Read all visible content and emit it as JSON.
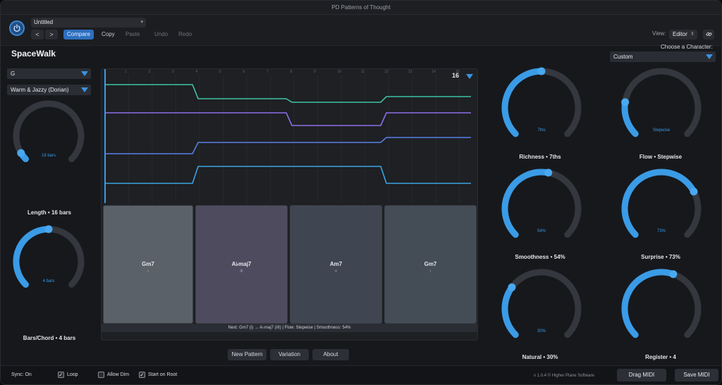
{
  "window": {
    "title": "PD Patterns of Thought"
  },
  "header": {
    "preset": "Untitled",
    "nav_prev": "<",
    "nav_next": ">",
    "compare": "Compare",
    "copy": "Copy",
    "paste": "Paste",
    "undo": "Undo",
    "redo": "Redo",
    "view_label": "View:",
    "view_value": "Editor",
    "link_icon": "link-icon"
  },
  "app_name": "SpaceWalk",
  "left": {
    "key": "G",
    "mode": "Warm & Jazzy (Dorian)",
    "knobs": [
      {
        "label": "Length • 16 bars",
        "inner": "16 bars",
        "level": 0.05
      },
      {
        "label": "Bars/Chord • 4 bars",
        "inner": "4 bars",
        "level": 0.5
      }
    ]
  },
  "editor": {
    "steps": "16",
    "beat_numbers": [
      "1",
      "2",
      "3",
      "4",
      "5",
      "6",
      "7",
      "8",
      "9",
      "10",
      "11",
      "12",
      "13",
      "14",
      "15",
      "16"
    ],
    "chords": [
      {
        "name": "Gm7",
        "numeral": "i"
      },
      {
        "name": "A♭maj7",
        "numeral": "III"
      },
      {
        "name": "Am7",
        "numeral": "ii"
      },
      {
        "name": "Gm7",
        "numeral": "i"
      }
    ],
    "status": "Next: Gm7 (i) → A♭maj7 (III)  |  Flow: Stepwise  |  Smoothness: 54%"
  },
  "buttons": {
    "new_pattern": "New Pattern",
    "variation": "Variation",
    "about": "About"
  },
  "right": {
    "choose_label": "Choose a Character:",
    "character": "Custom",
    "knobs": [
      {
        "label": "Richness • 7ths",
        "inner": "7ths",
        "level": 0.5
      },
      {
        "label": "Flow • Stepwise",
        "inner": "Stepwise",
        "level": 0.2
      },
      {
        "label": "Smoothness • 54%",
        "inner": "54%",
        "level": 0.54
      },
      {
        "label": "Surprise • 73%",
        "inner": "73%",
        "level": 0.73
      },
      {
        "label": "Natural • 30%",
        "inner": "30%",
        "level": 0.3
      },
      {
        "label": "Register • 4",
        "inner": "",
        "level": 0.57
      }
    ]
  },
  "footer": {
    "sync": "Sync: On",
    "loop": "Loop",
    "allow_dim": "Allow Dim",
    "start_on_root": "Start on Root",
    "version": "v 1.0.4 © Higher Plane Software",
    "drag_midi": "Drag MIDI",
    "save_midi": "Save MIDI",
    "checkmark": "✓"
  },
  "colors": {
    "accent": "#3a9be6",
    "voice_1": "#3fc3a4",
    "voice_2": "#8f6fe8",
    "voice_3": "#5a7fe6",
    "voice_4": "#3aa4e0"
  }
}
